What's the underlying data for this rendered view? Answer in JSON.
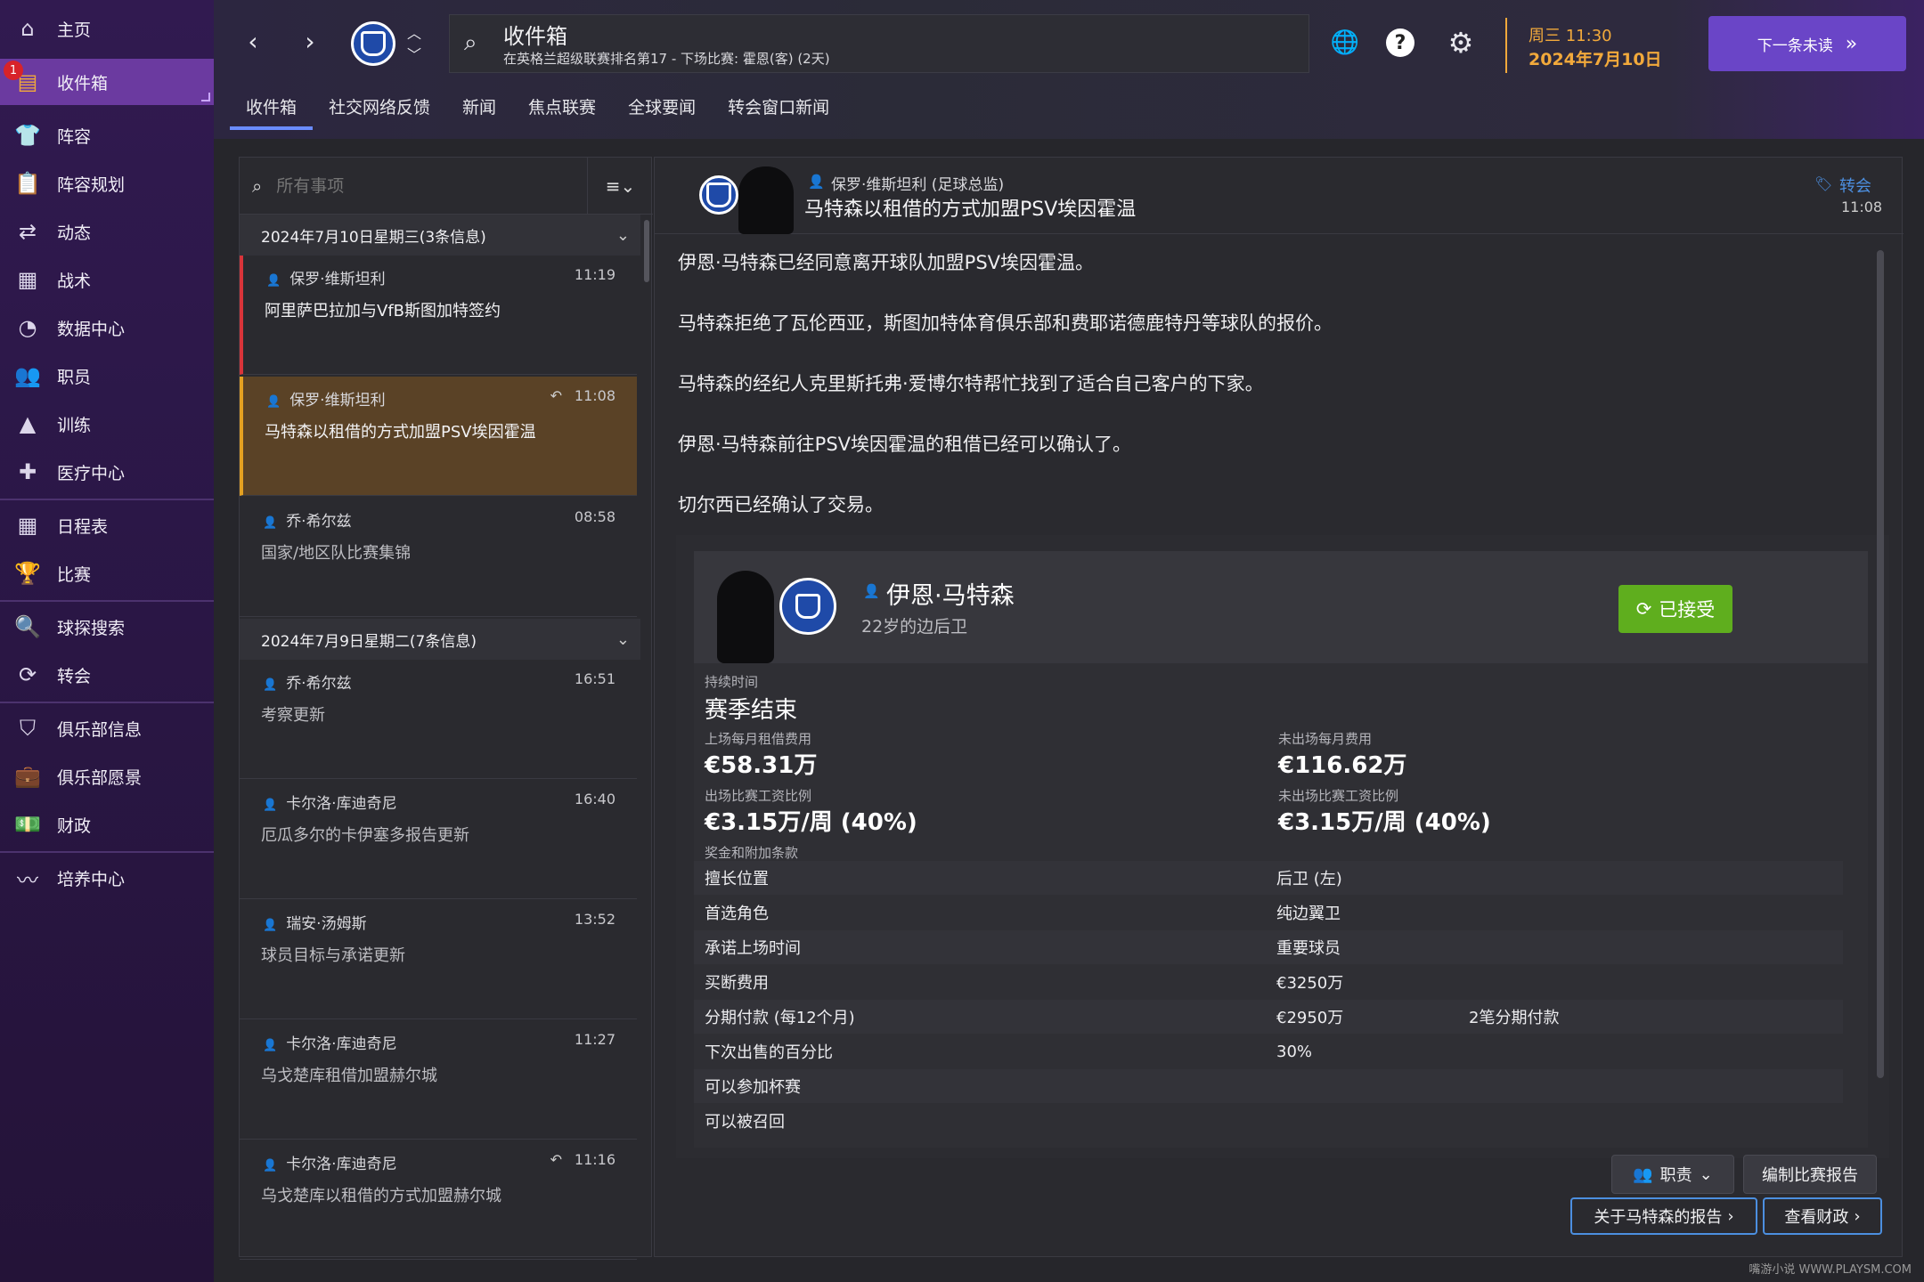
{
  "sidebar": {
    "badge": "1",
    "items": [
      {
        "label": "主页",
        "icon": "home-icon"
      },
      {
        "label": "收件箱",
        "icon": "inbox-icon"
      },
      {
        "label": "阵容",
        "icon": "shirt-icon"
      },
      {
        "label": "阵容规划",
        "icon": "clipboard-icon"
      },
      {
        "label": "动态",
        "icon": "dynamics-icon"
      },
      {
        "label": "战术",
        "icon": "tactics-icon"
      },
      {
        "label": "数据中心",
        "icon": "data-hub-icon"
      },
      {
        "label": "职员",
        "icon": "staff-icon"
      },
      {
        "label": "训练",
        "icon": "training-cone-icon"
      },
      {
        "label": "医疗中心",
        "icon": "medical-icon"
      },
      {
        "label": "日程表",
        "icon": "calendar-icon"
      },
      {
        "label": "比赛",
        "icon": "trophy-icon"
      },
      {
        "label": "球探搜索",
        "icon": "search-icon"
      },
      {
        "label": "转会",
        "icon": "transfer-icon"
      },
      {
        "label": "俱乐部信息",
        "icon": "shield-icon"
      },
      {
        "label": "俱乐部愿景",
        "icon": "briefcase-icon"
      },
      {
        "label": "财政",
        "icon": "money-icon"
      },
      {
        "label": "培养中心",
        "icon": "development-icon"
      }
    ]
  },
  "topbar": {
    "title": "收件箱",
    "subtitle": "在英格兰超级联赛排名第17 - 下场比赛: 霍恩(客) (2天)",
    "day_time": "周三 11:30",
    "date": "2024年7月10日",
    "next_label": "下一条未读",
    "tabs": [
      "收件箱",
      "社交网络反馈",
      "新闻",
      "焦点联赛",
      "全球要闻",
      "转会窗口新闻"
    ]
  },
  "inbox": {
    "search_placeholder": "所有事项",
    "groups": [
      {
        "header": "2024年7月10日星期三(3条信息)"
      },
      {
        "header": "2024年7月9日星期二(7条信息)"
      }
    ],
    "messages": [
      {
        "from": "保罗·维斯坦利",
        "time": "11:19",
        "subject": "阿里萨巴拉加与VfB斯图加特签约"
      },
      {
        "from": "保罗·维斯坦利",
        "time": "11:08",
        "subject": "马特森以租借的方式加盟PSV埃因霍温"
      },
      {
        "from": "乔·希尔兹",
        "time": "08:58",
        "subject": "国家/地区队比赛集锦"
      },
      {
        "from": "乔·希尔兹",
        "time": "16:51",
        "subject": "考察更新"
      },
      {
        "from": "卡尔洛·库迪奇尼",
        "time": "16:40",
        "subject": "厄瓜多尔的卡伊塞多报告更新"
      },
      {
        "from": "瑞安·汤姆斯",
        "time": "13:52",
        "subject": "球员目标与承诺更新"
      },
      {
        "from": "卡尔洛·库迪奇尼",
        "time": "11:27",
        "subject": "乌戈楚库租借加盟赫尔城"
      },
      {
        "from": "卡尔洛·库迪奇尼",
        "time": "11:16",
        "subject": "乌戈楚库以租借的方式加盟赫尔城"
      }
    ]
  },
  "detail": {
    "sender": "保罗·维斯坦利 (足球总监)",
    "headline": "马特森以租借的方式加盟PSV埃因霍温",
    "category": "转会",
    "time": "11:08",
    "paragraphs": [
      "伊恩·马特森已经同意离开球队加盟PSV埃因霍温。",
      "马特森拒绝了瓦伦西亚，斯图加特体育俱乐部和费耶诺德鹿特丹等球队的报价。",
      "马特森的经纪人克里斯托弗·爱博尔特帮忙找到了适合自己客户的下家。",
      "伊恩·马特森前往PSV埃因霍温的租借已经可以确认了。",
      "切尔西已经确认了交易。"
    ],
    "player": {
      "name": "伊恩·马特森",
      "desc": "22岁的边后卫",
      "status": "已接受"
    },
    "terms": {
      "duration_label": "持续时间",
      "duration": "赛季结束",
      "fee_played_label": "上场每月租借费用",
      "fee_played": "€58.31万",
      "fee_unplayed_label": "未出场每月费用",
      "fee_unplayed": "€116.62万",
      "wage_played_label": "出场比赛工资比例",
      "wage_played": "€3.15万/周 (40%)",
      "wage_unplayed_label": "未出场比赛工资比例",
      "wage_unplayed": "€3.15万/周 (40%)",
      "bonus_label": "奖金和附加条款"
    },
    "rows": [
      {
        "k": "擅长位置",
        "v": "后卫 (左)",
        "x": ""
      },
      {
        "k": "首选角色",
        "v": "纯边翼卫",
        "x": ""
      },
      {
        "k": "承诺上场时间",
        "v": "重要球员",
        "x": ""
      },
      {
        "k": "买断费用",
        "v": "€3250万",
        "x": ""
      },
      {
        "k": "分期付款 (每12个月)",
        "v": "€2950万",
        "x": "2笔分期付款"
      },
      {
        "k": "下次出售的百分比",
        "v": "30%",
        "x": ""
      },
      {
        "k": "可以参加杯赛",
        "v": "",
        "x": ""
      },
      {
        "k": "可以被召回",
        "v": "",
        "x": ""
      }
    ],
    "buttons": {
      "duty": "职责",
      "match_report": "编制比赛报告",
      "about_report": "关于马特森的报告",
      "finance": "查看财政"
    }
  },
  "watermark": "嘴游小说 WWW.PLAYSM.COM"
}
